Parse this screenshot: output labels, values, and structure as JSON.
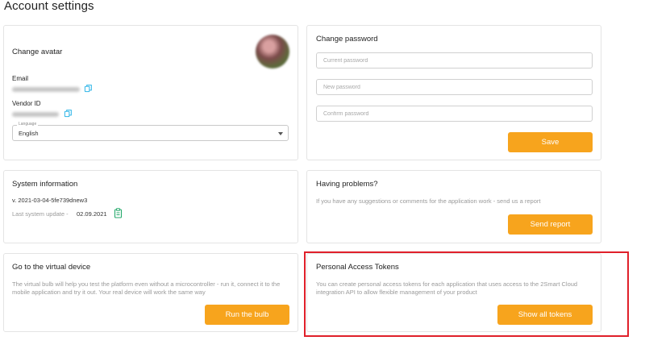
{
  "page": {
    "title": "Account settings"
  },
  "avatar_card": {
    "title": "Change avatar",
    "email_label": "Email",
    "vendor_label": "Vendor ID",
    "language_legend": "Language",
    "language_value": "English"
  },
  "password_card": {
    "title": "Change password",
    "current_placeholder": "Current password",
    "new_placeholder": "New password",
    "confirm_placeholder": "Confirm password",
    "save_label": "Save"
  },
  "system_card": {
    "title": "System information",
    "version": "v. 2021-03-04-5fe739dnew3",
    "last_update_label": "Last system update -",
    "last_update_date": "02.09.2021"
  },
  "problems_card": {
    "title": "Having problems?",
    "text": "If you have any suggestions or comments for the application work - send us a report",
    "button_label": "Send report"
  },
  "virtual_card": {
    "title": "Go to the virtual device",
    "text": "The virtual bulb will help you test the platform even without a microcontroller - run it, connect it to the mobile application and try it out. Your real device will work the same way",
    "button_label": "Run the bulb"
  },
  "tokens_card": {
    "title": "Personal Access Tokens",
    "text": "You can create personal access tokens for each application that uses access to the 2Smart Cloud integration API to allow flexible management of your product",
    "button_label": "Show all tokens"
  },
  "colors": {
    "accent": "#f7a41d",
    "highlight": "#e0202a",
    "copy_icon": "#2fb5e8",
    "clipboard_icon": "#25a96b"
  },
  "icons": {
    "copy": "copy-icon",
    "clipboard": "clipboard-icon",
    "dropdown": "chevron-down-icon"
  }
}
